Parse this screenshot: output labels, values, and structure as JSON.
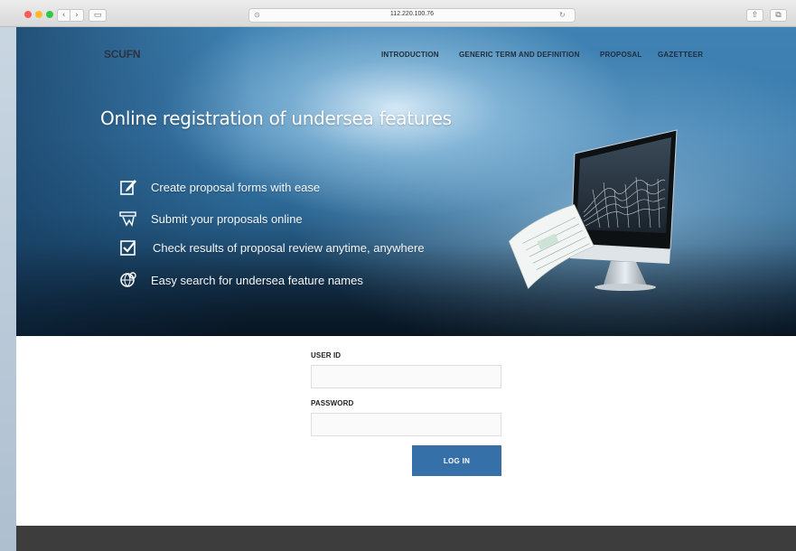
{
  "browser": {
    "url": "112.220.100.76",
    "back_glyph": "‹",
    "forward_glyph": "›",
    "sidebar_glyph": "▭",
    "reload_glyph": "↻",
    "reader_glyph": "⊙",
    "share_glyph": "⇧",
    "tabs_glyph": "⧉",
    "icons": [
      "back-icon",
      "forward-icon",
      "sidebar-icon",
      "reader-icon",
      "reload-icon",
      "share-icon",
      "tabs-icon"
    ]
  },
  "site": {
    "logo": "SCUFN",
    "nav": [
      "INTRODUCTION",
      "GENERIC TERM AND DEFINITION",
      "PROPOSAL",
      "GAZETTEER"
    ]
  },
  "hero": {
    "headline": "Online registration of undersea features",
    "features": [
      {
        "icon": "edit-form-icon",
        "text": "Create proposal forms with ease"
      },
      {
        "icon": "submit-icon",
        "text": "Submit your proposals online"
      },
      {
        "icon": "checkbox-icon",
        "text": "Check results of proposal review anytime, anywhere"
      },
      {
        "icon": "globe-search-icon",
        "text": "Easy search for undersea feature names"
      }
    ],
    "illustration": "monitor-with-seafloor-map"
  },
  "login": {
    "user_label": "USER ID",
    "user_value": "",
    "password_label": "PASSWORD",
    "password_value": "",
    "button_label": "LOG IN",
    "button_color": "#3570a9"
  },
  "colors": {
    "hero_top": "#3f82b3",
    "hero_bottom": "#0b1b2b",
    "footer": "#3d3d3d"
  }
}
